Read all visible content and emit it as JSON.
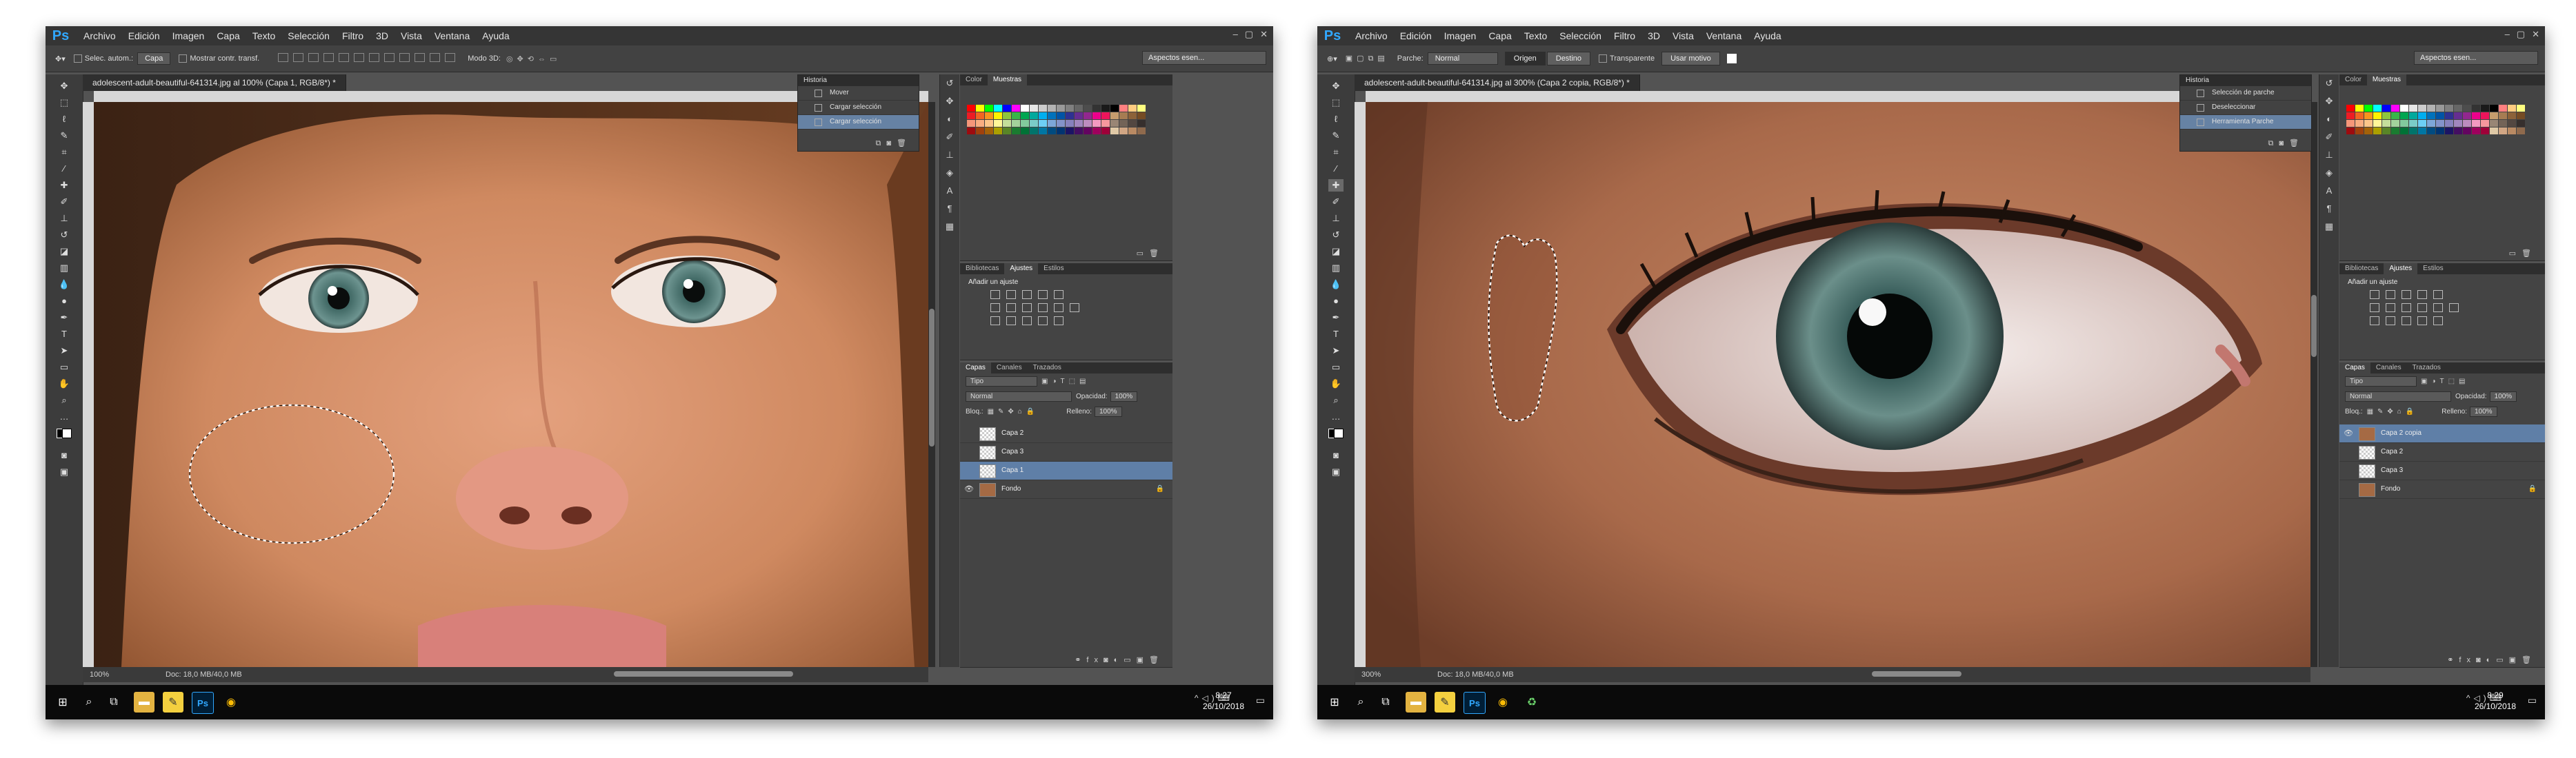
{
  "menu": [
    "Archivo",
    "Edición",
    "Imagen",
    "Capa",
    "Texto",
    "Selección",
    "Filtro",
    "3D",
    "Vista",
    "Ventana",
    "Ayuda"
  ],
  "app_logo": "Ps",
  "window_controls": [
    "–",
    "▢",
    "✕"
  ],
  "left": {
    "options": {
      "auto_select": "Selec. autom.:",
      "auto_select_value": "Capa",
      "show_transform": "Mostrar contr. transf.",
      "mode_3d": "Modo 3D:",
      "workspace": "Aspectos esen..."
    },
    "doc_title": "adolescent-adult-beautiful-641314.jpg al 100% (Capa 1, RGB/8*) *",
    "history": {
      "title": "Historia",
      "items": [
        "Mover",
        "Cargar selección",
        "Cargar selección"
      ],
      "selected_index": 2
    },
    "status": {
      "zoom": "100%",
      "doc": "Doc: 18,0 MB/40,0 MB"
    },
    "layers": [
      {
        "name": "Capa 2",
        "thumb": "checker",
        "visible": false,
        "locked": false,
        "selected": false
      },
      {
        "name": "Capa 3",
        "thumb": "checker",
        "visible": false,
        "locked": false,
        "selected": false
      },
      {
        "name": "Capa 1",
        "thumb": "checker",
        "visible": false,
        "locked": false,
        "selected": true
      },
      {
        "name": "Fondo",
        "thumb": "photo",
        "visible": true,
        "locked": true,
        "selected": false
      }
    ],
    "clock": {
      "time": "8:27",
      "date": "26/10/2018"
    }
  },
  "right": {
    "options": {
      "patch": "Parche:",
      "patch_value": "Normal",
      "origin": "Origen",
      "destination": "Destino",
      "transparent": "Transparente",
      "use_pattern": "Usar motivo",
      "workspace": "Aspectos esen..."
    },
    "doc_title": "adolescent-adult-beautiful-641314.jpg al 300% (Capa 2 copia, RGB/8*) *",
    "history": {
      "title": "Historia",
      "items": [
        "Selección de parche",
        "Deseleccionar",
        "Herramienta Parche"
      ],
      "selected_index": 2
    },
    "status": {
      "zoom": "300%",
      "doc": "Doc: 18,0 MB/40,0 MB"
    },
    "layers": [
      {
        "name": "Capa 2 copia",
        "thumb": "photo",
        "visible": true,
        "locked": false,
        "selected": true
      },
      {
        "name": "Capa 2",
        "thumb": "checker",
        "visible": false,
        "locked": false,
        "selected": false
      },
      {
        "name": "Capa 3",
        "thumb": "checker",
        "visible": false,
        "locked": false,
        "selected": false
      },
      {
        "name": "Fondo",
        "thumb": "photo",
        "visible": false,
        "locked": true,
        "selected": false
      }
    ],
    "clock": {
      "time": "8:29",
      "date": "26/10/2018"
    }
  },
  "panel_tabs": {
    "color": [
      "Color",
      "Muestras"
    ],
    "libs": [
      "Bibliotecas",
      "Ajustes",
      "Estilos"
    ],
    "layers": [
      "Capas",
      "Canales",
      "Trazados"
    ]
  },
  "adjust_title": "Añadir un ajuste",
  "layers_panel": {
    "kind": "Tipo",
    "blend": "Normal",
    "opacity_label": "Opacidad:",
    "opacity": "100%",
    "lock_label": "Bloq.:",
    "fill_label": "Relleno:",
    "fill": "100%"
  },
  "swatches": [
    "#ff0000",
    "#ffff00",
    "#00ff00",
    "#00ffff",
    "#0000ff",
    "#ff00ff",
    "#ffffff",
    "#e6e6e6",
    "#cccccc",
    "#b3b3b3",
    "#999999",
    "#808080",
    "#666666",
    "#4d4d4d",
    "#333333",
    "#1a1a1a",
    "#000000",
    "#ff8080",
    "#ffcc80",
    "#ffff80",
    "#ed1c24",
    "#f26522",
    "#f7941d",
    "#fff200",
    "#8dc63f",
    "#39b54a",
    "#00a651",
    "#00a99d",
    "#00aeef",
    "#0072bc",
    "#0054a6",
    "#2e3192",
    "#662d91",
    "#92278f",
    "#ec008c",
    "#ed145b",
    "#c69c6d",
    "#a67c52",
    "#8c6239",
    "#754c24",
    "#f69679",
    "#f9ad81",
    "#fdc68a",
    "#fff799",
    "#c4df9b",
    "#a3d39c",
    "#82ca9d",
    "#7accc8",
    "#6dcff6",
    "#7da7d9",
    "#8393ca",
    "#8781bd",
    "#a186be",
    "#bd8cbf",
    "#f49ac1",
    "#f6989d",
    "#998675",
    "#736357",
    "#534741",
    "#362f2d",
    "#9e0b0f",
    "#a0410d",
    "#a36209",
    "#aba000",
    "#598527",
    "#1a7b30",
    "#007236",
    "#00746b",
    "#0076a3",
    "#004b80",
    "#003471",
    "#1b1464",
    "#440e62",
    "#630460",
    "#9e005d",
    "#9e0039",
    "#e0c9a6",
    "#d1a684",
    "#b98a63",
    "#8f6a4d"
  ]
}
